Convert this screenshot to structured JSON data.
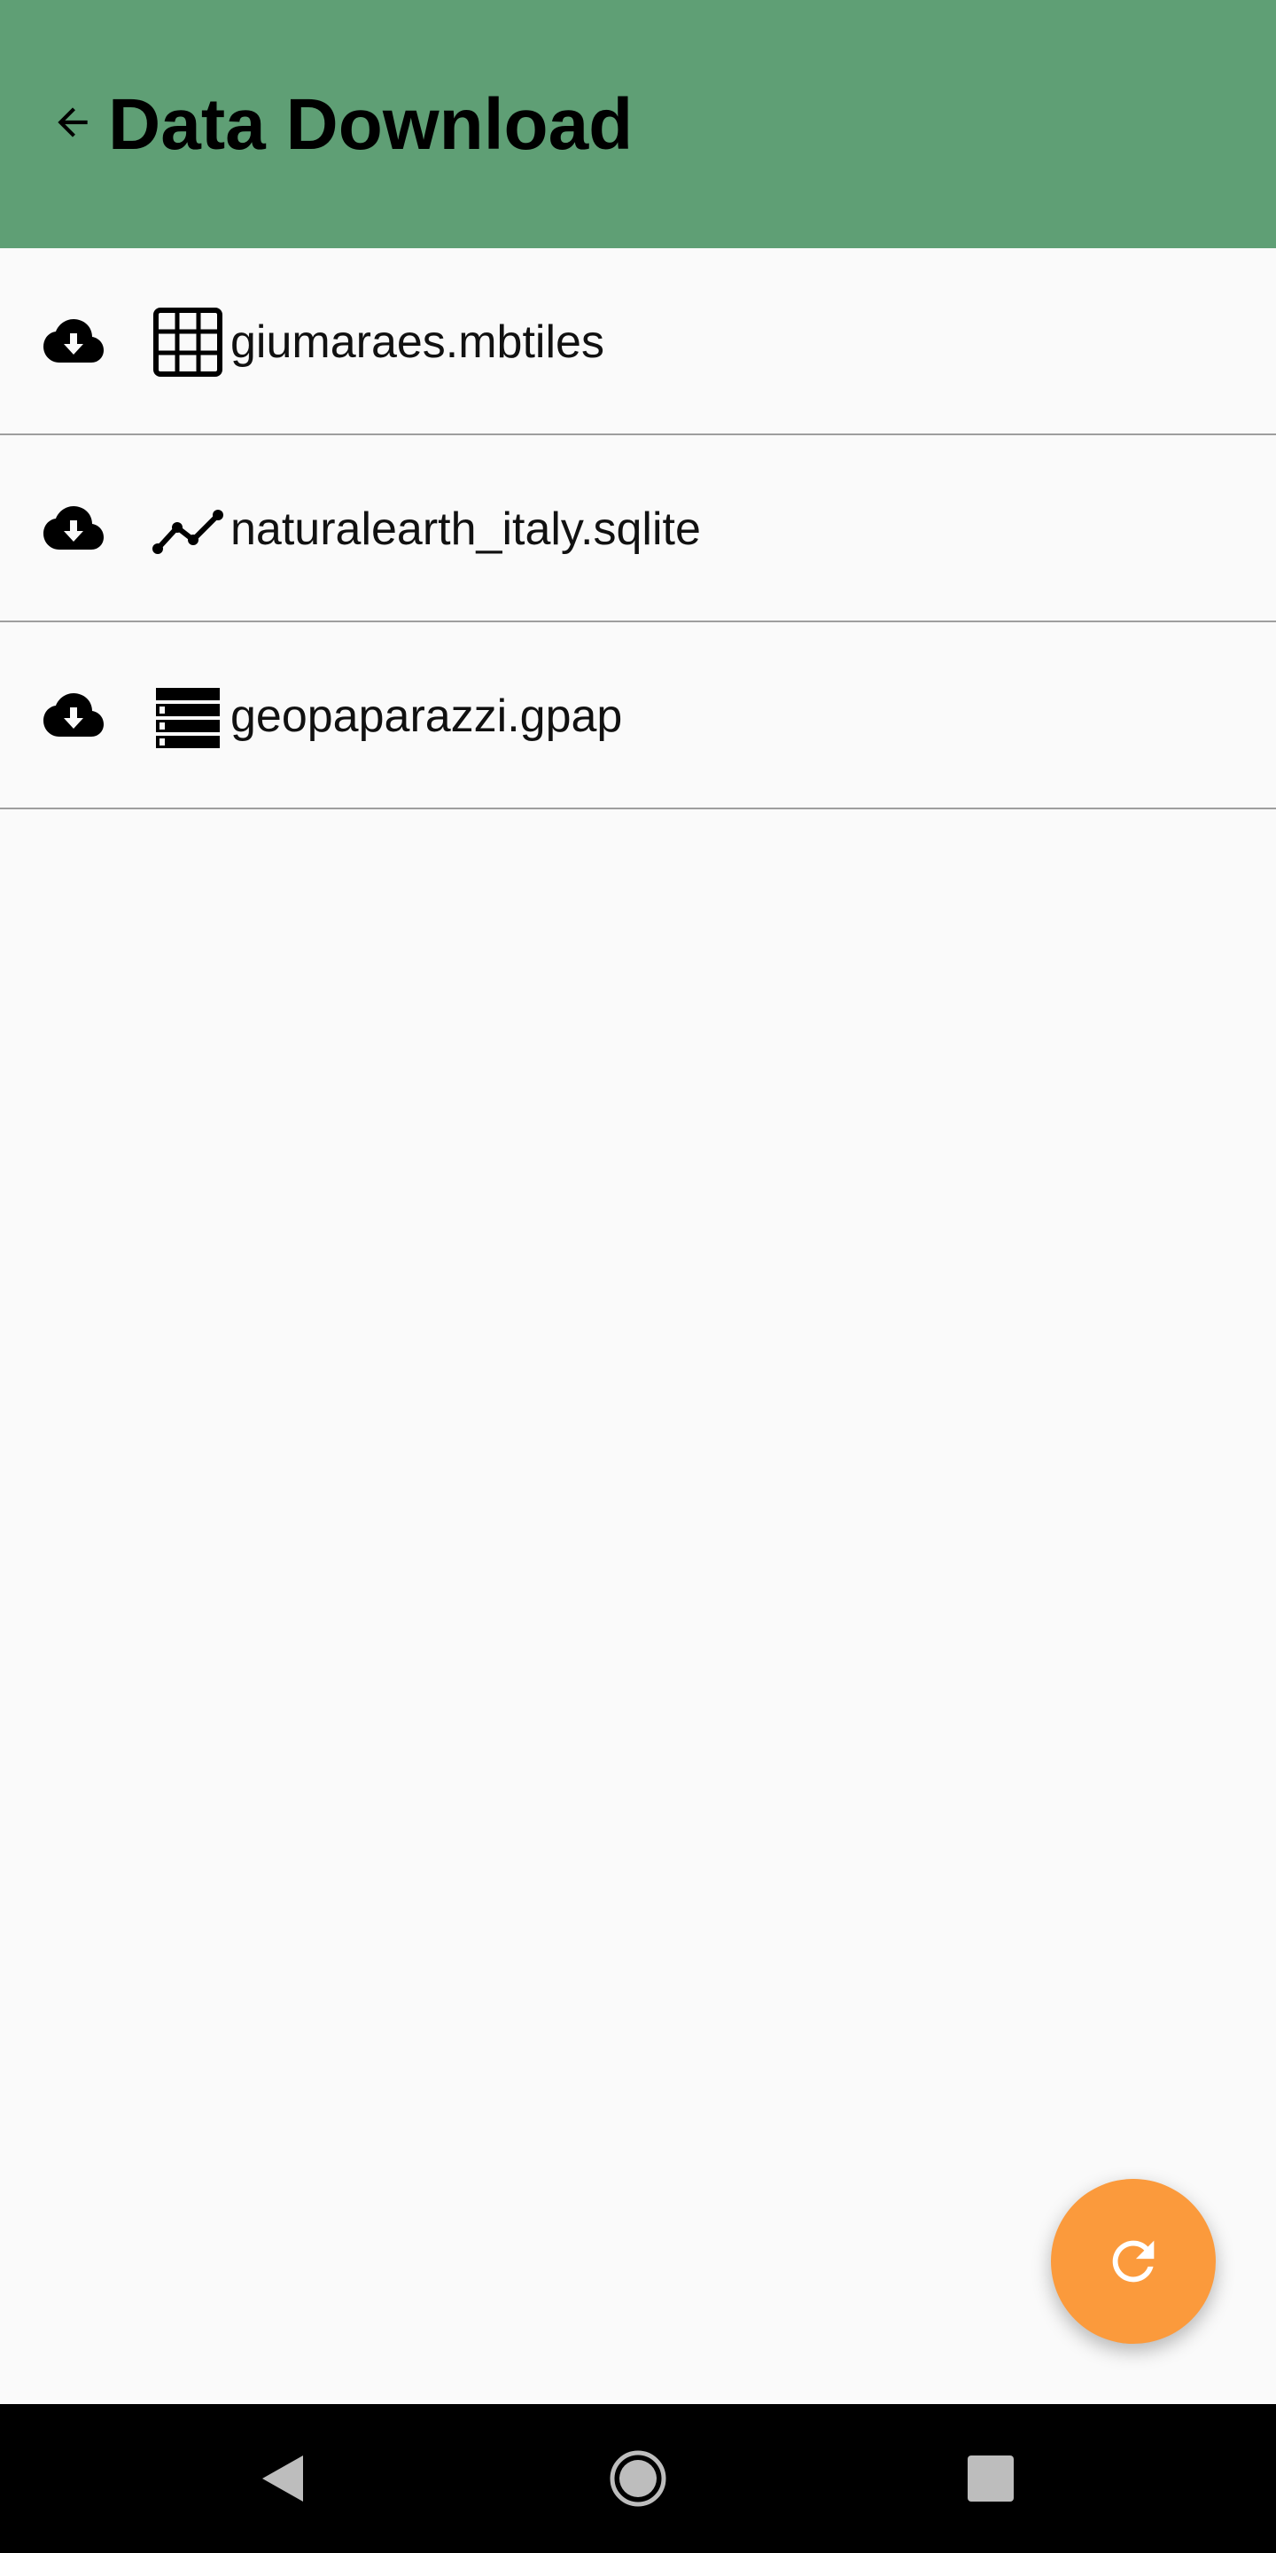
{
  "appbar": {
    "title": "Data Download",
    "color": "#5f9f75",
    "back_icon": "arrow-left-icon"
  },
  "files": [
    {
      "name": "giumaraes.mbtiles",
      "action_icon": "cloud-download-icon",
      "type_icon": "grid-icon"
    },
    {
      "name": "naturalearth_italy.sqlite",
      "action_icon": "cloud-download-icon",
      "type_icon": "polyline-icon"
    },
    {
      "name": "geopaparazzi.gpap",
      "action_icon": "cloud-download-icon",
      "type_icon": "database-list-icon"
    }
  ],
  "fab": {
    "icon": "refresh-icon",
    "color": "#fb9a3c"
  },
  "navbar": {
    "buttons": [
      "back-triangle-icon",
      "home-circle-icon",
      "recents-square-icon"
    ]
  }
}
